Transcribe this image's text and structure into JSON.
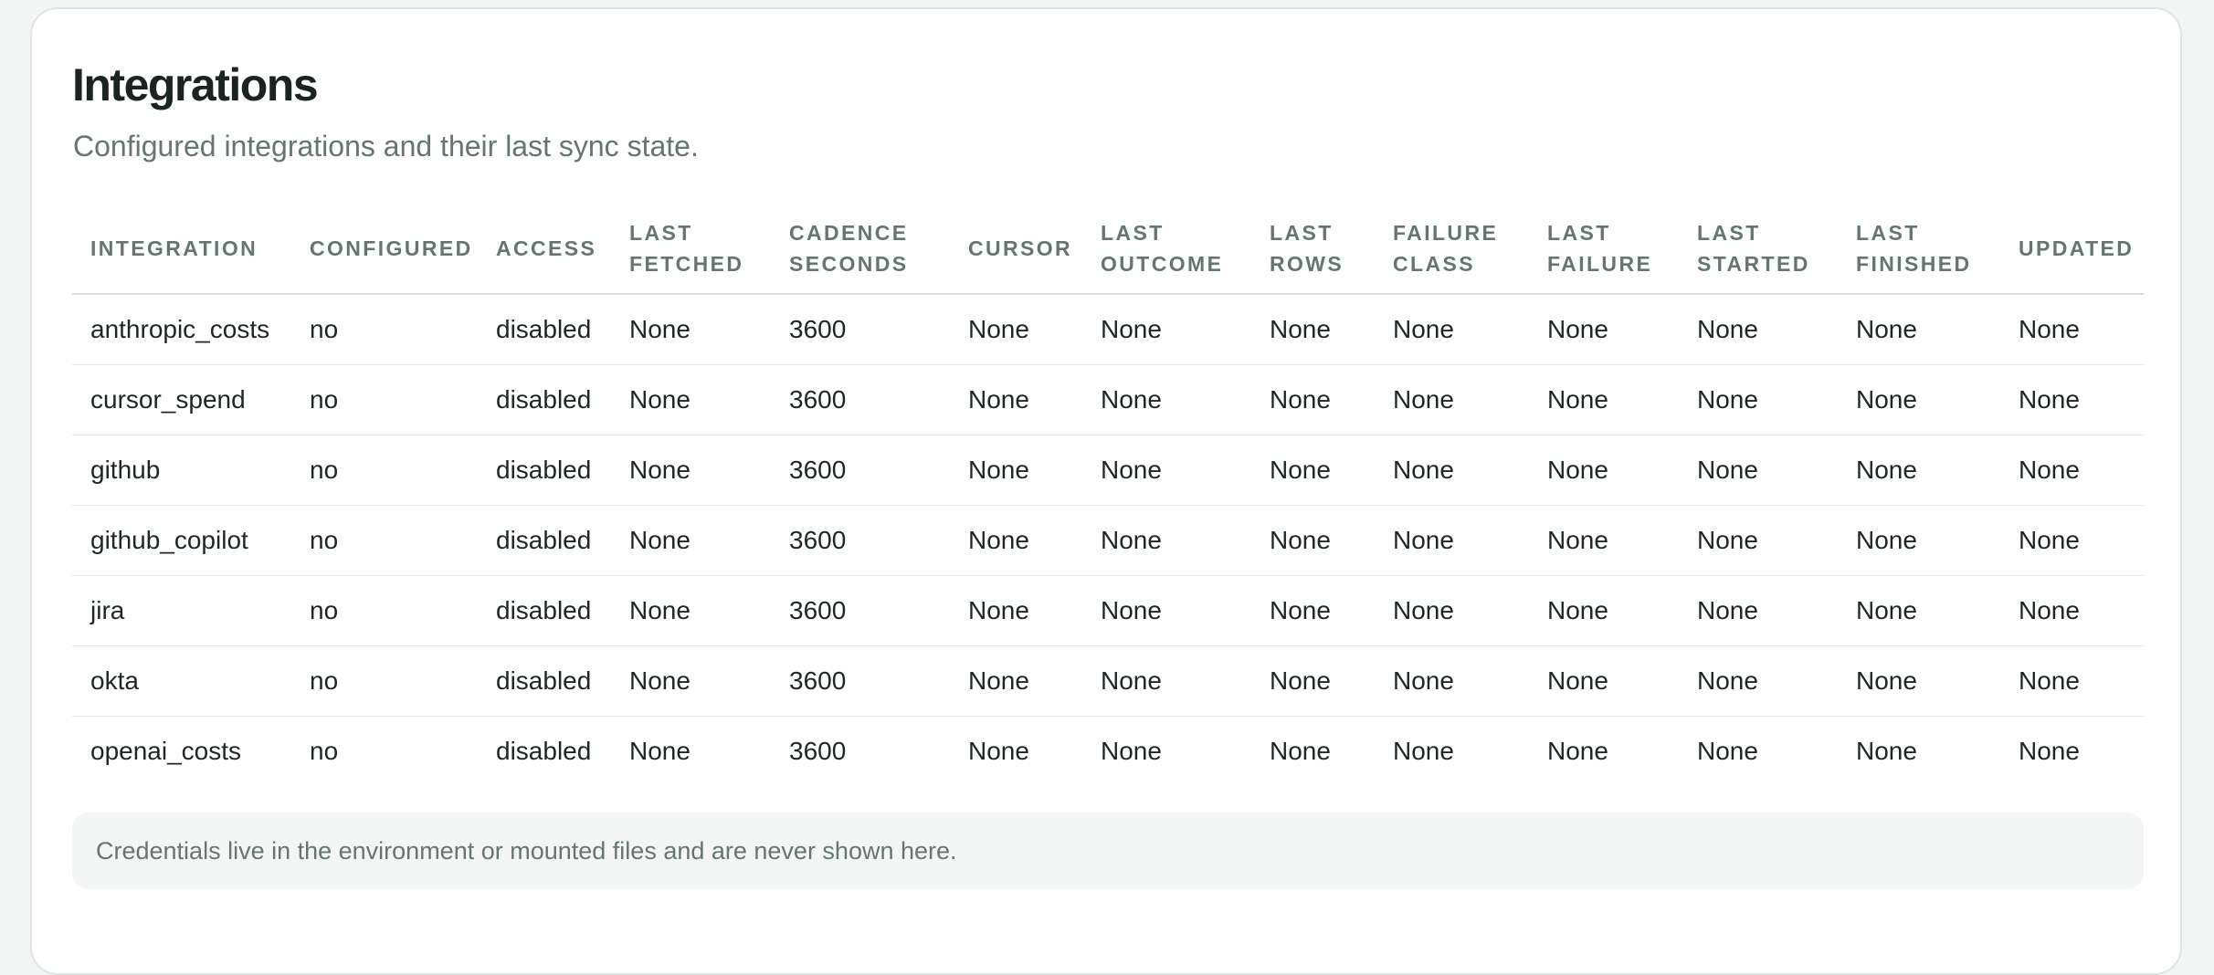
{
  "header": {
    "title": "Integrations",
    "subtitle": "Configured integrations and their last sync state."
  },
  "table": {
    "columns": [
      [
        "INTEGRATION"
      ],
      [
        "CONFIGURED"
      ],
      [
        "ACCESS"
      ],
      [
        "LAST",
        "FETCHED"
      ],
      [
        "CADENCE",
        "SECONDS"
      ],
      [
        "CURSOR"
      ],
      [
        "LAST",
        "OUTCOME"
      ],
      [
        "LAST",
        "ROWS"
      ],
      [
        "FAILURE",
        "CLASS"
      ],
      [
        "LAST",
        "FAILURE"
      ],
      [
        "LAST",
        "STARTED"
      ],
      [
        "LAST",
        "FINISHED"
      ],
      [
        "UPDATED"
      ]
    ],
    "rows": [
      [
        "anthropic_costs",
        "no",
        "disabled",
        "None",
        "3600",
        "None",
        "None",
        "None",
        "None",
        "None",
        "None",
        "None",
        "None"
      ],
      [
        "cursor_spend",
        "no",
        "disabled",
        "None",
        "3600",
        "None",
        "None",
        "None",
        "None",
        "None",
        "None",
        "None",
        "None"
      ],
      [
        "github",
        "no",
        "disabled",
        "None",
        "3600",
        "None",
        "None",
        "None",
        "None",
        "None",
        "None",
        "None",
        "None"
      ],
      [
        "github_copilot",
        "no",
        "disabled",
        "None",
        "3600",
        "None",
        "None",
        "None",
        "None",
        "None",
        "None",
        "None",
        "None"
      ],
      [
        "jira",
        "no",
        "disabled",
        "None",
        "3600",
        "None",
        "None",
        "None",
        "None",
        "None",
        "None",
        "None",
        "None"
      ],
      [
        "okta",
        "no",
        "disabled",
        "None",
        "3600",
        "None",
        "None",
        "None",
        "None",
        "None",
        "None",
        "None",
        "None"
      ],
      [
        "openai_costs",
        "no",
        "disabled",
        "None",
        "3600",
        "None",
        "None",
        "None",
        "None",
        "None",
        "None",
        "None",
        "None"
      ]
    ]
  },
  "footer": {
    "note": "Credentials live in the environment or mounted files and are never shown here."
  }
}
